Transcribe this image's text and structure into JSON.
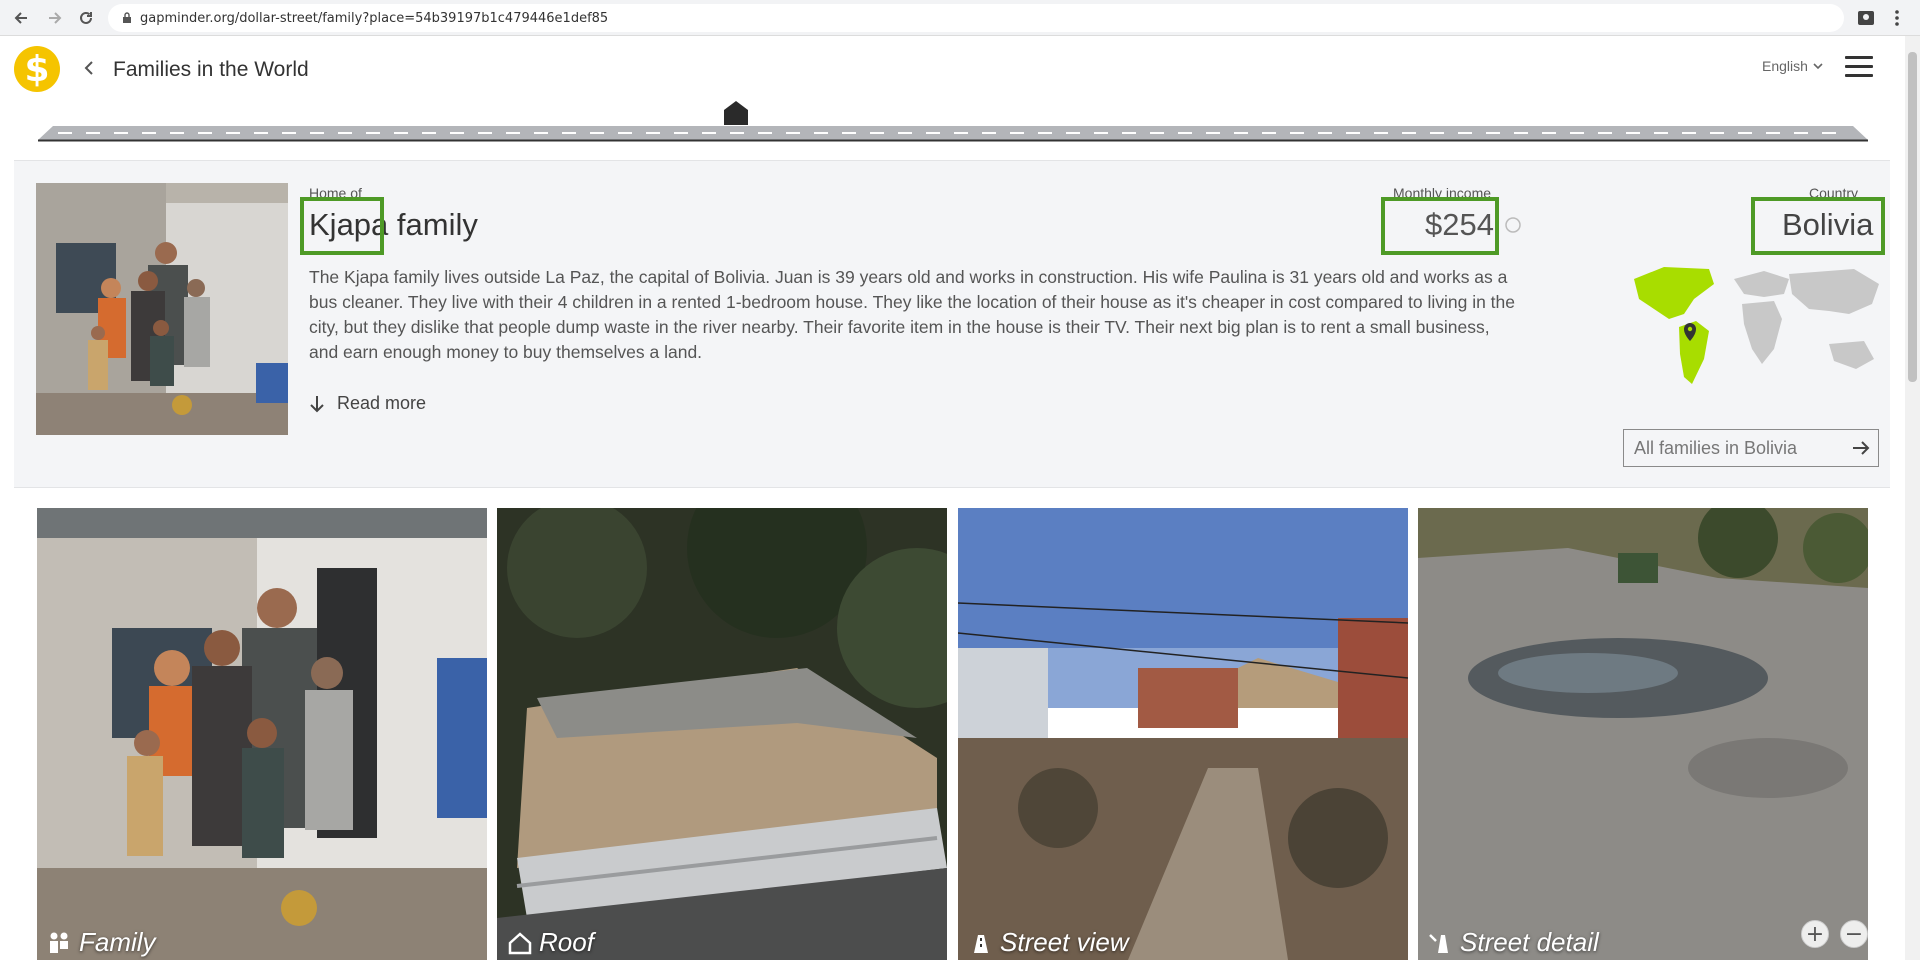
{
  "browser": {
    "url": "gapminder.org/dollar-street/family?place=54b39197b1c479446e1def85",
    "back_icon": "arrow-left-icon",
    "forward_icon": "arrow-right-icon",
    "reload_icon": "reload-icon"
  },
  "header": {
    "logo_glyph": "$",
    "title": "Families in the World",
    "language": "English"
  },
  "family": {
    "home_of_label": "Home of",
    "name": "Kjapa family",
    "description": "The Kjapa family lives outside La Paz, the capital of Bolivia. Juan is 39 years old and works in construction. His wife Paulina is 31 years old and works as a bus cleaner. They live with their 4 children in a rented 1-bedroom house. They like the location of their house as it's cheaper in cost compared to living in the city, but they dislike that people dump waste in the river nearby. Their favorite item in the house is their TV. Their next big plan is to rent a small business, and earn enough money to buy themselves a land.",
    "read_more": "Read more"
  },
  "income": {
    "label": "Monthly income",
    "value": "$254"
  },
  "country": {
    "label": "Country",
    "value": "Bolivia",
    "all_families_button": "All families in Bolivia"
  },
  "photos": [
    {
      "label": "Family",
      "icon": "family-icon"
    },
    {
      "label": "Roof",
      "icon": "house-icon"
    },
    {
      "label": "Street view",
      "icon": "street-view-icon"
    },
    {
      "label": "Street detail",
      "icon": "street-detail-icon"
    }
  ],
  "zoom": {
    "plus": "+",
    "minus": "−"
  },
  "colors": {
    "highlight": "#4e9a26",
    "logo": "#f5c400",
    "map_highlight": "#a8dd00"
  }
}
